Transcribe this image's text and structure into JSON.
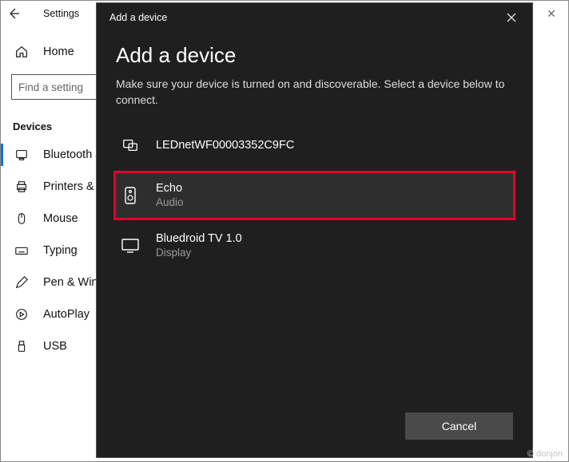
{
  "settings": {
    "window_title": "Settings",
    "home_label": "Home",
    "search_placeholder": "Find a setting",
    "section_title": "Devices",
    "items": [
      {
        "label": "Bluetooth & o"
      },
      {
        "label": "Printers & sca"
      },
      {
        "label": "Mouse"
      },
      {
        "label": "Typing"
      },
      {
        "label": "Pen & Window"
      },
      {
        "label": "AutoPlay"
      },
      {
        "label": "USB"
      }
    ]
  },
  "modal": {
    "titlebar": "Add a device",
    "heading": "Add a device",
    "subtitle": "Make sure your device is turned on and discoverable. Select a device below to connect.",
    "devices": [
      {
        "name": "LEDnetWF00003352C9FC",
        "sub": ""
      },
      {
        "name": "Echo",
        "sub": "Audio"
      },
      {
        "name": "Bluedroid TV 1.0",
        "sub": "Display"
      }
    ],
    "cancel_label": "Cancel"
  },
  "watermark": "© donjon"
}
